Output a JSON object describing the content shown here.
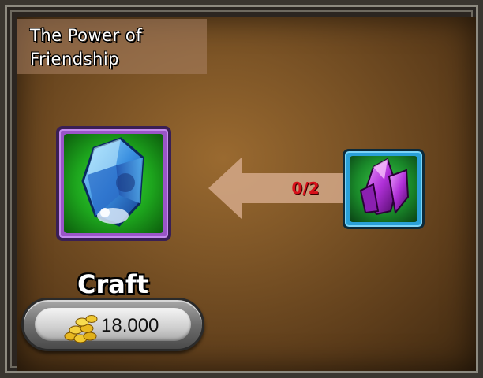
{
  "recipe": {
    "title_line1": "The Power of",
    "title_line2": "Friendship"
  },
  "result_item": {
    "icon": "blue-crystal-icon",
    "border_color": "#9a55c8"
  },
  "ingredient": {
    "icon": "purple-crystal-icon",
    "count_text": "0/2",
    "border_color": "#2aa0d8"
  },
  "craft": {
    "label": "Craft",
    "cost": "18.000",
    "currency_icon": "gold-coins-icon"
  },
  "colors": {
    "count": "#d8101a",
    "panel": "#7c5426"
  }
}
